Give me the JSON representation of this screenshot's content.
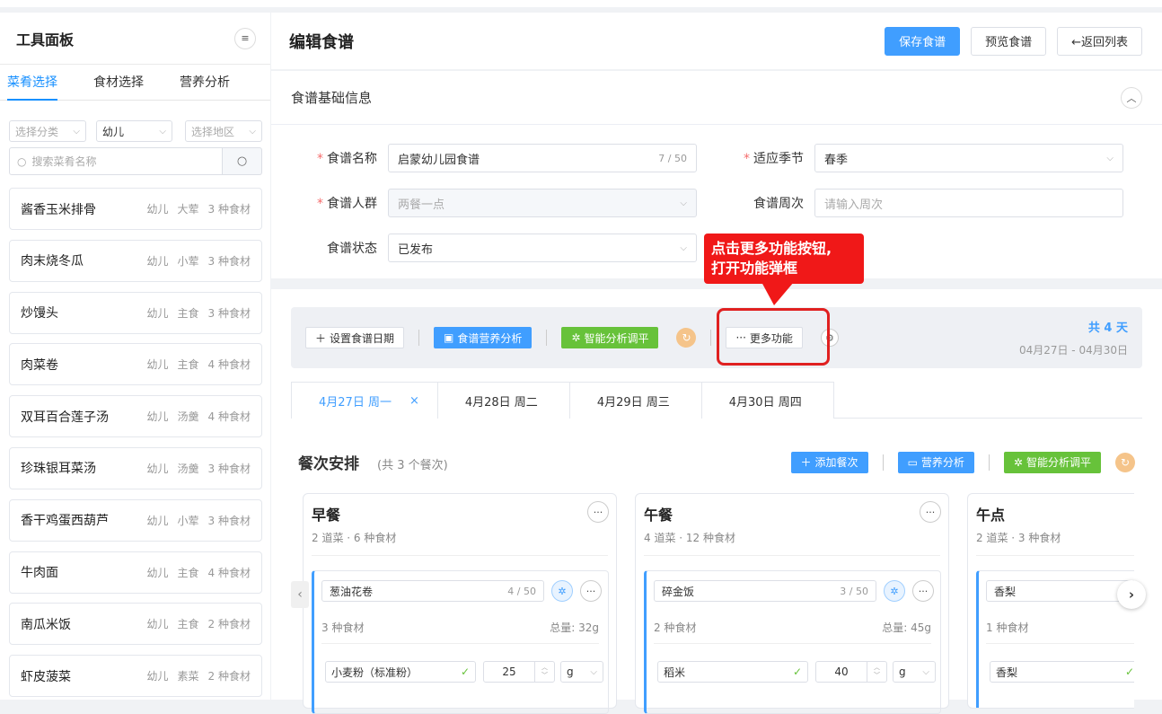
{
  "left": {
    "title": "工具面板",
    "tabs": [
      "菜肴选择",
      "食材选择",
      "营养分析"
    ],
    "filters": {
      "category": "选择分类",
      "crowd": "幼儿",
      "region": "选择地区"
    },
    "search_placeholder": "搜索菜肴名称",
    "dishes": [
      {
        "name": "酱香玉米排骨",
        "crowd": "幼儿",
        "type": "大荤",
        "count": "3 种食材"
      },
      {
        "name": "肉末烧冬瓜",
        "crowd": "幼儿",
        "type": "小荤",
        "count": "3 种食材"
      },
      {
        "name": "炒馒头",
        "crowd": "幼儿",
        "type": "主食",
        "count": "3 种食材"
      },
      {
        "name": "肉菜卷",
        "crowd": "幼儿",
        "type": "主食",
        "count": "4 种食材"
      },
      {
        "name": "双耳百合莲子汤",
        "crowd": "幼儿",
        "type": "汤羹",
        "count": "4 种食材"
      },
      {
        "name": "珍珠银耳菜汤",
        "crowd": "幼儿",
        "type": "汤羹",
        "count": "3 种食材"
      },
      {
        "name": "香干鸡蛋西葫芦",
        "crowd": "幼儿",
        "type": "小荤",
        "count": "3 种食材"
      },
      {
        "name": "牛肉面",
        "crowd": "幼儿",
        "type": "主食",
        "count": "4 种食材"
      },
      {
        "name": "南瓜米饭",
        "crowd": "幼儿",
        "type": "主食",
        "count": "2 种食材"
      },
      {
        "name": "虾皮菠菜",
        "crowd": "幼儿",
        "type": "素菜",
        "count": "2 种食材"
      }
    ]
  },
  "header": {
    "title": "编辑食谱",
    "save": "保存食谱",
    "preview": "预览食谱",
    "back": "←返回列表"
  },
  "basic": {
    "title": "食谱基础信息",
    "name_label": "食谱名称",
    "name_value": "启蒙幼儿园食谱",
    "name_count": "7 / 50",
    "season_label": "适应季节",
    "season_value": "春季",
    "crowd_label": "食谱人群",
    "crowd_value": "两餐一点",
    "week_label": "食谱周次",
    "week_placeholder": "请输入周次",
    "status_label": "食谱状态",
    "status_value": "已发布"
  },
  "toolbar": {
    "set_date": "设置食谱日期",
    "nutrition": "食谱营养分析",
    "smart": "智能分析调平",
    "more": "更多功能",
    "days": "共 4 天",
    "range": "04月27日 - 04月30日"
  },
  "callout": {
    "line1": "点击更多功能按钮,",
    "line2": "打开功能弹框"
  },
  "date_tabs": [
    "4月27日 周一",
    "4月28日 周二",
    "4月29日 周三",
    "4月30日 周四"
  ],
  "meals_section": {
    "title": "餐次安排",
    "count": "(共 3 个餐次)",
    "add": "添加餐次",
    "nutrition": "营养分析",
    "smart": "智能分析调平"
  },
  "meals": [
    {
      "title": "早餐",
      "sub": "2 道菜 · 6 种食材",
      "dish": "葱油花卷",
      "dish_count": "4 / 50",
      "ing_count": "3 种食材",
      "total": "总量: 32g",
      "ingredient": "小麦粉（标准粉）",
      "amount": "25",
      "unit": "g"
    },
    {
      "title": "午餐",
      "sub": "4 道菜 · 12 种食材",
      "dish": "碎金饭",
      "dish_count": "3 / 50",
      "ing_count": "2 种食材",
      "total": "总量: 45g",
      "ingredient": "稻米",
      "amount": "40",
      "unit": "g"
    },
    {
      "title": "午点",
      "sub": "2 道菜 · 3 种食材",
      "dish": "香梨",
      "dish_count": "",
      "ing_count": "1 种食材",
      "total": "",
      "ingredient": "香梨",
      "amount": "",
      "unit": ""
    }
  ]
}
